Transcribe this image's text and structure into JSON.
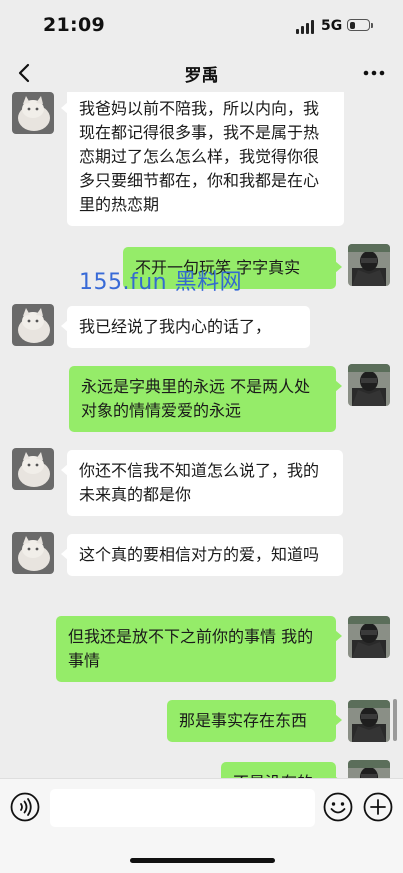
{
  "status_bar": {
    "time": "21:09",
    "network": "5G",
    "battery_level": 0.3
  },
  "nav": {
    "title": "罗禹"
  },
  "watermark": {
    "text": "155.fun 黑料网"
  },
  "messages": [
    {
      "side": "left",
      "text": "我爸妈以前不陪我，所以内向，我现在都记得很多事，我不是属于热恋期过了怎么怎么样，我觉得你很多只要细节都在，你和我都是在心里的热恋期"
    },
    {
      "side": "right",
      "text": "不开一句玩笑  字字真实"
    },
    {
      "side": "left",
      "text": "我已经说了我内心的话了，"
    },
    {
      "side": "right",
      "text": "永远是字典里的永远  不是两人处对象的情情爱爱的永远"
    },
    {
      "side": "left",
      "text": "你还不信我不知道怎么说了，我的未来真的都是你"
    },
    {
      "side": "left",
      "text": "这个真的要相信对方的爱，知道吗"
    },
    {
      "side": "right",
      "text": "但我还是放不下之前你的事情 我的事情"
    },
    {
      "side": "right",
      "text": "那是事实存在东西"
    },
    {
      "side": "right",
      "text": "不是没有的"
    }
  ],
  "input": {
    "value": "",
    "placeholder": ""
  },
  "icons": {
    "back": "chevron-left-icon",
    "more": "more-dots-icon",
    "voice": "voice-icon",
    "emoji": "emoji-icon",
    "plus": "plus-icon"
  },
  "colors": {
    "background": "#ededed",
    "bubble_sent": "#95ec69",
    "bubble_received": "#ffffff",
    "watermark": "#2f64d6"
  }
}
